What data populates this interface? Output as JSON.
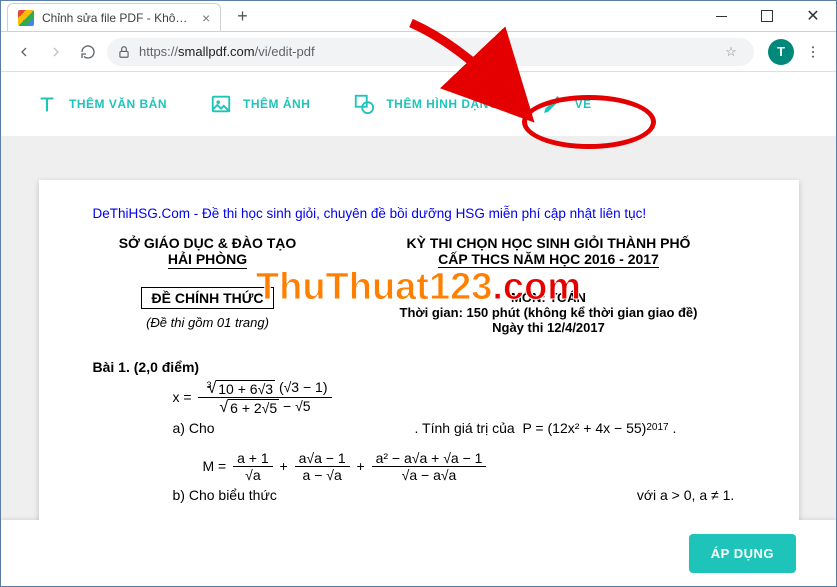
{
  "browser": {
    "tab_title": "Chỉnh sửa file PDF - Không ảnh h",
    "url_scheme": "https://",
    "url_host": "smallpdf.com",
    "url_path": "/vi/edit-pdf",
    "avatar_letter": "T"
  },
  "toolbar": {
    "text_label": "THÊM VĂN BẢN",
    "image_label": "THÊM ẢNH",
    "shape_label": "THÊM HÌNH DẠNG",
    "draw_label": "VẼ"
  },
  "document": {
    "top_line": "DeThiHSG.Com - Đề thi học sinh giỏi, chuyên đề bồi dưỡng HSG miễn phí cập nhật liên tục!",
    "dept_line1": "SỞ GIÁO DỤC & ĐÀO TẠO",
    "dept_line2": "HẢI PHÒNG",
    "exam_line1": "KỲ THI CHỌN HỌC SINH GIỎI THÀNH PHỐ",
    "exam_line2": "CẤP THCS NĂM HỌC 2016 - 2017",
    "boxed": "ĐỀ CHÍNH THỨC",
    "pages_note": "(Đề thi gồm 01 trang)",
    "subject_label": "MÔN:",
    "subject": "TOÁN",
    "time_note": "Thời gian: 150 phút (không kể thời gian giao đề)",
    "date_note": "Ngày thi 12/4/2017",
    "bai1_title": "Bài 1. (2,0 điểm)",
    "bai1_a_prefix": "a) Cho",
    "bai1_eq_x": "x =",
    "bai1_eq_num_inner": "10 + 6√3",
    "bai1_eq_num_tail": "(√3 − 1)",
    "bai1_eq_den_inner": "6 + 2√5",
    "bai1_eq_den_tail": "− √5",
    "bai1_a_mid": ". Tính giá trị của",
    "bai1_eq_P": "P = (12x² + 4x − 55)",
    "bai1_exponent": "2017",
    "bai1_b_prefix": "b) Cho biểu thức",
    "bai1_eq_M_lhs": "M =",
    "bai1_M_f1_num": "a + 1",
    "bai1_M_f1_den": "√a",
    "bai1_M_f2_num": "a√a − 1",
    "bai1_M_f2_den": "a − √a",
    "bai1_M_f3_num": "a² − a√a + √a − 1",
    "bai1_M_f3_den": "√a − a√a",
    "bai1_b_cond": "với a > 0, a ≠ 1."
  },
  "watermark": {
    "part1": "ThuThuat123",
    "part2": ".com"
  },
  "footer": {
    "apply_label": "ÁP DỤNG"
  }
}
